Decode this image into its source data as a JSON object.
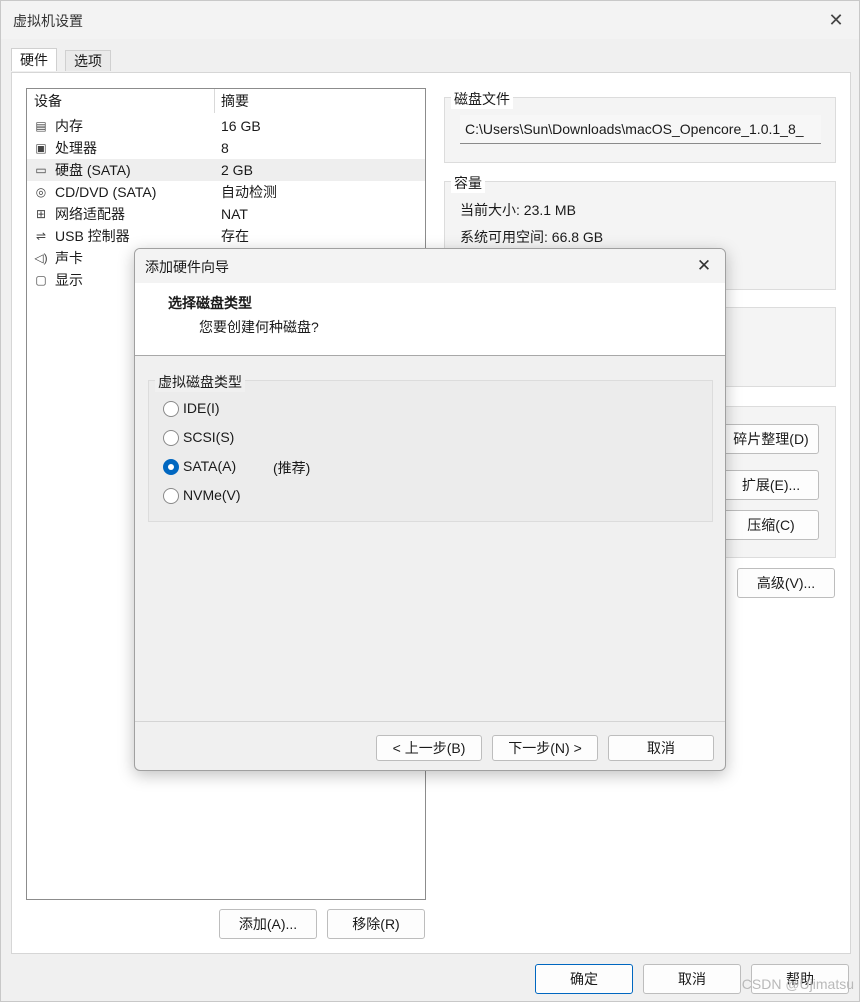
{
  "window": {
    "title": "虚拟机设置",
    "close": "✕"
  },
  "tabs": [
    {
      "label": "硬件"
    },
    {
      "label": "选项"
    }
  ],
  "device_table": {
    "headers": {
      "device": "设备",
      "summary": "摘要"
    },
    "rows": [
      {
        "icon": "memory-icon",
        "glyph": "▤",
        "name": "内存",
        "summary": "16 GB"
      },
      {
        "icon": "processor-icon",
        "glyph": "▣",
        "name": "处理器",
        "summary": "8"
      },
      {
        "icon": "hard-disk-icon",
        "glyph": "▭",
        "name": "硬盘 (SATA)",
        "summary": "2 GB"
      },
      {
        "icon": "cd-dvd-icon",
        "glyph": "◎",
        "name": "CD/DVD (SATA)",
        "summary": "自动检测"
      },
      {
        "icon": "network-adapter-icon",
        "glyph": "⊞",
        "name": "网络适配器",
        "summary": "NAT"
      },
      {
        "icon": "usb-controller-icon",
        "glyph": "⇌",
        "name": "USB 控制器",
        "summary": "存在"
      },
      {
        "icon": "sound-card-icon",
        "glyph": "◁)",
        "name": "声卡",
        "summary": ""
      },
      {
        "icon": "display-icon",
        "glyph": "▢",
        "name": "显示",
        "summary": ""
      }
    ]
  },
  "disk_file": {
    "label": "磁盘文件",
    "value": "C:\\Users\\Sun\\Downloads\\macOS_Opencore_1.0.1_8_"
  },
  "capacity": {
    "label": "容量",
    "current": "当前大小: 23.1 MB",
    "free": "系统可用空间: 66.8 GB"
  },
  "utilities": {
    "defrag": "碎片整理(D)",
    "expand": "扩展(E)...",
    "compact": "压缩(C)",
    "advanced": "高级(V)..."
  },
  "list_buttons": {
    "add": "添加(A)...",
    "remove": "移除(R)"
  },
  "footer": {
    "ok": "确定",
    "cancel": "取消",
    "help": "帮助"
  },
  "wizard": {
    "title": "添加硬件向导",
    "close": "✕",
    "heading": "选择磁盘类型",
    "subheading": "您要创建何种磁盘?",
    "group_label": "虚拟磁盘类型",
    "options": [
      {
        "label": "IDE(I)",
        "selected": false,
        "note": ""
      },
      {
        "label": "SCSI(S)",
        "selected": false,
        "note": ""
      },
      {
        "label": "SATA(A)",
        "selected": true,
        "note": "(推荐)"
      },
      {
        "label": "NVMe(V)",
        "selected": false,
        "note": ""
      }
    ],
    "buttons": {
      "back": "< 上一步(B)",
      "next": "下一步(N) >",
      "cancel": "取消"
    }
  },
  "watermark": "CSDN @Ujimatsu"
}
